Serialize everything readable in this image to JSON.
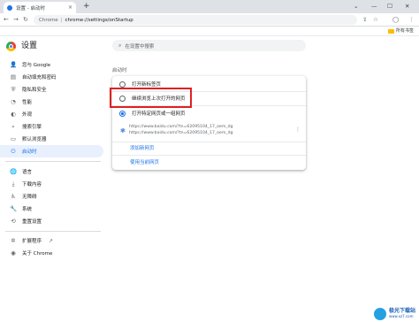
{
  "tab": {
    "title": "设置 - 启动时",
    "close": "×",
    "new_tab": "+"
  },
  "window_controls": {
    "dropdown": "⌄",
    "minimize": "—",
    "maximize": "☐",
    "close": "✕"
  },
  "toolbar": {
    "back": "←",
    "forward": "→",
    "reload": "↻",
    "chip": "Chrome",
    "separator": "|",
    "url": "chrome://settings/onStartup",
    "share": "⇪",
    "star": "☆",
    "profile": "◯",
    "menu": "⋮"
  },
  "bookmarks": {
    "label": "所有书签"
  },
  "header": {
    "title": "设置"
  },
  "search": {
    "icon": "⌕",
    "placeholder": "在设置中搜索"
  },
  "sidebar": {
    "items": [
      {
        "icon": "👤",
        "label": "您与 Google"
      },
      {
        "icon": "▤",
        "label": "自动填充和密码"
      },
      {
        "icon": "⛨",
        "label": "隐私和安全"
      },
      {
        "icon": "◔",
        "label": "性能"
      },
      {
        "icon": "◐",
        "label": "外观"
      },
      {
        "icon": "⌕",
        "label": "搜索引擎"
      },
      {
        "icon": "▭",
        "label": "默认浏览器"
      },
      {
        "icon": "⏻",
        "label": "启动时"
      },
      {
        "icon": "🌐",
        "label": "语言"
      },
      {
        "icon": "⤓",
        "label": "下载内容"
      },
      {
        "icon": "♿",
        "label": "无障碍"
      },
      {
        "icon": "🔧",
        "label": "系统"
      },
      {
        "icon": "⟲",
        "label": "重置设置"
      },
      {
        "icon": "✲",
        "label": "扩展程序"
      },
      {
        "icon": "◉",
        "label": "关于 Chrome"
      }
    ],
    "extensions_external": "↗"
  },
  "startup": {
    "section_title": "启动时",
    "options": [
      {
        "label": "打开新标签页",
        "selected": false
      },
      {
        "label": "继续浏览上次打开的网页",
        "selected": false
      },
      {
        "label": "打开特定网页或一组网页",
        "selected": true
      }
    ],
    "pages": [
      {
        "icon": "❃",
        "url1": "https://www.baidu.com/?tn=62095104_17_oem_dg",
        "url2": "https://www.baidu.com/?tn=62095104_17_oem_dg",
        "menu": "⋮"
      }
    ],
    "add_page": "添加新网页",
    "use_current": "使用当前网页"
  },
  "watermark": {
    "title": "极光下载站",
    "url": "www.xz7.com"
  },
  "colors": {
    "accent": "#1a73e8",
    "highlight_box": "#e02020",
    "active_bg": "#e8f0fe"
  }
}
